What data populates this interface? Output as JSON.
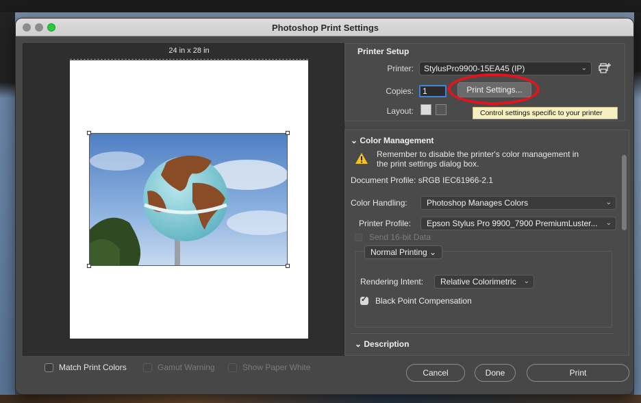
{
  "window": {
    "title": "Photoshop Print Settings"
  },
  "preview": {
    "paper_size": "24 in x 28 in"
  },
  "bottom_left": {
    "match_print_colors": "Match Print Colors",
    "gamut_warning": "Gamut Warning",
    "show_paper_white": "Show Paper White"
  },
  "printer_setup": {
    "title": "Printer Setup",
    "printer_label": "Printer:",
    "printer_value": "StylusPro9900-15EA45 (IP)",
    "copies_label": "Copies:",
    "copies_value": "1",
    "print_settings_button": "Print Settings...",
    "layout_label": "Layout:",
    "tooltip": "Control settings specific to your printer"
  },
  "color_management": {
    "title": "Color Management",
    "warning_text": "Remember to disable the printer's color management in the print settings dialog box.",
    "document_profile": "Document Profile: sRGB IEC61966-2.1",
    "color_handling_label": "Color Handling:",
    "color_handling_value": "Photoshop Manages Colors",
    "printer_profile_label": "Printer Profile:",
    "printer_profile_value": "Epson Stylus Pro 9900_7900 PremiumLuster...",
    "send_16bit": "Send 16-bit Data",
    "normal_printing": "Normal Printing",
    "rendering_intent_label": "Rendering Intent:",
    "rendering_intent_value": "Relative Colorimetric",
    "black_point_compensation": "Black Point Compensation",
    "description_title": "Description"
  },
  "buttons": {
    "cancel": "Cancel",
    "done": "Done",
    "print": "Print"
  },
  "icons": {
    "warning": "warning-triangle-icon",
    "add_printer": "add-printer-icon"
  },
  "colors": {
    "dialog_bg": "#474747",
    "accent_blue": "#3e83dc",
    "highlight_red": "#e5141c",
    "warning_yellow": "#f5c41a",
    "tooltip_bg": "#f6efc1"
  }
}
